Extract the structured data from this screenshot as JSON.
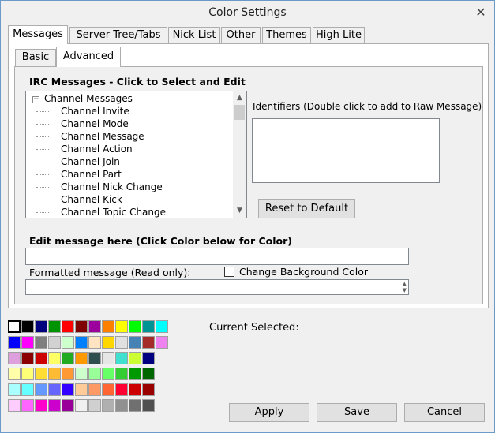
{
  "window": {
    "title": "Color Settings",
    "close_glyph": "✕"
  },
  "tabs": [
    {
      "label": "Messages",
      "active": true
    },
    {
      "label": "Server Tree/Tabs",
      "active": false
    },
    {
      "label": "Nick List",
      "active": false
    },
    {
      "label": "Other",
      "active": false
    },
    {
      "label": "Themes",
      "active": false
    },
    {
      "label": "High Lite",
      "active": false
    }
  ],
  "subtabs": [
    {
      "label": "Basic",
      "active": false
    },
    {
      "label": "Advanced",
      "active": true
    }
  ],
  "irc_messages": {
    "title": "IRC Messages - Click to Select and Edit",
    "root": "Channel Messages",
    "items": [
      "Channel Invite",
      "Channel Mode",
      "Channel Message",
      "Channel Action",
      "Channel Join",
      "Channel Part",
      "Channel Nick Change",
      "Channel Kick",
      "Channel Topic Change"
    ],
    "expander_glyph": "−",
    "scroll_up_glyph": "▲",
    "scroll_down_glyph": "▼"
  },
  "identifiers": {
    "label": "Identifiers (Double click to add to Raw Message)"
  },
  "reset_button": "Reset to Default",
  "edit_message": {
    "label": "Edit message here (Click Color below for Color)",
    "value": ""
  },
  "formatted_message": {
    "label": "Formatted message (Read only):",
    "value": ""
  },
  "change_bg": {
    "label": "Change Background Color",
    "checked": false
  },
  "current_selected": {
    "label": "Current Selected:"
  },
  "palette": {
    "rows": [
      [
        "#ffffff",
        "#000000",
        "#00007f",
        "#009300",
        "#ff0000",
        "#7f0000",
        "#9c009c",
        "#fc7f00",
        "#ffff00",
        "#00fc00",
        "#009393",
        "#00ffff"
      ],
      [
        "#0000fc",
        "#ff00ff",
        "#7f7f7f",
        "#d2d2d2",
        "#ccffcc",
        "#0080ff",
        "#ffe4c4",
        "#ffd700",
        "#e0e0e0",
        "#4682b4",
        "#a52a2a",
        "#ee82ee"
      ],
      [
        "#dda0dd",
        "#8b0000",
        "#cc0000",
        "#ffff66",
        "#22aa22",
        "#ff9900",
        "#2f4f4f",
        "#e6e6e6",
        "#40e0d0",
        "#ccff33",
        "#000080"
      ],
      [
        "#ffffaa",
        "#ffff77",
        "#ffdd33",
        "#ffbb33",
        "#ff9933",
        "#ccffcc",
        "#99ff99",
        "#66ff66",
        "#33cc33",
        "#009900",
        "#006600"
      ],
      [
        "#aaffff",
        "#66ffff",
        "#6699ff",
        "#6666ff",
        "#3300ff",
        "#ffcc99",
        "#ff9966",
        "#ff6633",
        "#ff0033",
        "#cc0000",
        "#990000"
      ],
      [
        "#ffccff",
        "#ff66ff",
        "#ff00cc",
        "#cc00cc",
        "#990099",
        "#f0f0f0",
        "#d0d0d0",
        "#b0b0b0",
        "#909090",
        "#707070",
        "#505050"
      ]
    ]
  },
  "buttons": {
    "apply": "Apply",
    "save": "Save",
    "cancel": "Cancel"
  }
}
